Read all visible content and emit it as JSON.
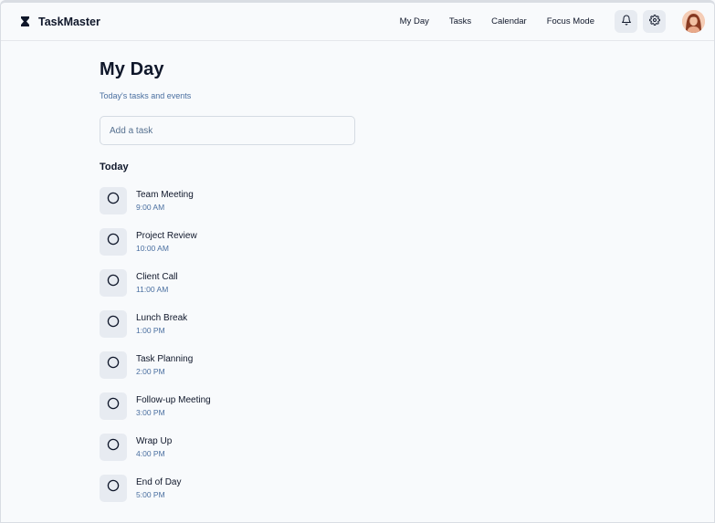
{
  "app": {
    "name": "TaskMaster"
  },
  "nav": {
    "items": [
      "My Day",
      "Tasks",
      "Calendar",
      "Focus Mode"
    ]
  },
  "header_icons": {
    "notifications": "bell-icon",
    "settings": "gear-icon",
    "avatar": "user-avatar"
  },
  "page": {
    "title": "My Day",
    "subtitle": "Today's tasks and events",
    "input_placeholder": "Add a task",
    "section_title": "Today"
  },
  "tasks": [
    {
      "name": "Team Meeting",
      "time": "9:00 AM"
    },
    {
      "name": "Project Review",
      "time": "10:00 AM"
    },
    {
      "name": "Client Call",
      "time": "11:00 AM"
    },
    {
      "name": "Lunch Break",
      "time": "1:00 PM"
    },
    {
      "name": "Task Planning",
      "time": "2:00 PM"
    },
    {
      "name": "Follow-up Meeting",
      "time": "3:00 PM"
    },
    {
      "name": "Wrap Up",
      "time": "4:00 PM"
    },
    {
      "name": "End of Day",
      "time": "5:00 PM"
    }
  ],
  "colors": {
    "accent_text": "#4a6fa0",
    "icon_bg": "#e7ebf1",
    "background": "#f8fafc"
  }
}
